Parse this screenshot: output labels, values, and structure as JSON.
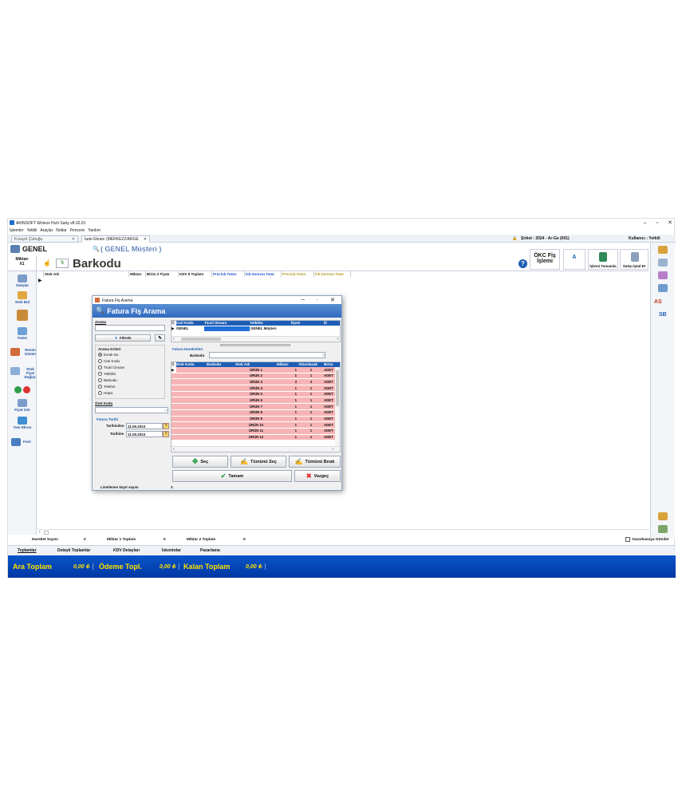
{
  "app": {
    "title": "AKINSOFT Wolvox Hızlı Satış v8.02.01",
    "menu": [
      "İşlemler",
      "Yetkili",
      "Araçlar",
      "Notlar",
      "Pencere",
      "Yardım"
    ],
    "tabs": [
      {
        "label": "Kısayol Çubuğu"
      },
      {
        "label": "İade Ekranı (MERKEZ2/ARGE"
      }
    ],
    "company": "Şirket : 2024 - Ar-Ge (001)",
    "user": "Kullanıcı : Yetkili"
  },
  "header": {
    "customer_code": "GENEL",
    "customer_name": "( GENEL Müşteri )",
    "qty_label": "Miktarı",
    "qty_value": "X1",
    "barcode_label": "Barkodu",
    "okc_label": "ÖKC Fiş İşlemi",
    "a_label": "A",
    "complete_label": "İşlemi Tamamla",
    "cancel_sale_label": "Satışı İptal Et"
  },
  "left_toolbar": [
    "Satışlar",
    "Stok Bul",
    "",
    "Paket",
    "Resim Göster",
    "Stok Fiyat Değişt.",
    "",
    "Fiyat Gör",
    "Tam Ekran",
    "Font"
  ],
  "right_toolbar": {
    "as": "AS",
    "sb": "SB"
  },
  "grid_columns": [
    "Stok Adı",
    "Miktarı",
    "Birim 2 Fiyatı",
    "KDV $ Toplam",
    "Prm.İsk.Tutarı",
    "İsk.Sonrası Tutar",
    "Prm.İsk.Tutarı",
    "İsk.Sonrası Tutar"
  ],
  "dialog": {
    "window_title": "Fatura Fiş Arama",
    "header": "Fatura Fiş Arama",
    "search_label": "Arama",
    "filter_button": "Filtrele",
    "criteria_label": "Arama Kriteri",
    "criteria": [
      "Evrak No",
      "Cari Kodu",
      "Ticari Ünvanı",
      "Yetkilisi",
      "Barkodu",
      "Telefon",
      "Hepsi"
    ],
    "special_code_label": "Özel Kodu",
    "invoice_date_label": "Fatura Tarihi",
    "date_from_label": "Tarihinden",
    "date_from": "11.06.2024",
    "date_to_label": "Tarihine",
    "date_to": "11.06.2024",
    "top_columns": [
      "Cari Kodu",
      "Ticari Ünvanı",
      "Yetkilisi",
      "İlçesi",
      "İli"
    ],
    "top_row": {
      "code": "GENEL",
      "name": "",
      "contact": "GENEL Müşteri"
    },
    "movements_label": "Fatura Hareketleri",
    "barcode_label": "Barkodu",
    "item_columns": [
      "Stok Kodu",
      "Barkodu",
      "Stok Adı",
      "Miktarı",
      "Aktarılacak",
      "Birim"
    ],
    "items": [
      {
        "name": "ÜRÜN 1",
        "qty": "1",
        "transfer": "1",
        "unit": "ADET"
      },
      {
        "name": "ÜRÜN 2",
        "qty": "1",
        "transfer": "1",
        "unit": "ADET"
      },
      {
        "name": "ÜRÜN 3",
        "qty": "3",
        "transfer": "3",
        "unit": "ADET"
      },
      {
        "name": "ÜRÜN 4",
        "qty": "1",
        "transfer": "1",
        "unit": "ADET"
      },
      {
        "name": "ÜRÜN 5",
        "qty": "1",
        "transfer": "1",
        "unit": "ADET"
      },
      {
        "name": "ÜRÜN 6",
        "qty": "1",
        "transfer": "1",
        "unit": "ADET"
      },
      {
        "name": "ÜRÜN 7",
        "qty": "1",
        "transfer": "1",
        "unit": "ADET"
      },
      {
        "name": "ÜRÜN 8",
        "qty": "1",
        "transfer": "1",
        "unit": "ADET"
      },
      {
        "name": "ÜRÜN 9",
        "qty": "1",
        "transfer": "1",
        "unit": "ADET"
      },
      {
        "name": "ÜRÜN 10",
        "qty": "1",
        "transfer": "1",
        "unit": "ADET"
      },
      {
        "name": "ÜRÜN 11",
        "qty": "1",
        "transfer": "1",
        "unit": "ADET"
      },
      {
        "name": "ÜRÜN 12",
        "qty": "1",
        "transfer": "1",
        "unit": "ADET"
      }
    ],
    "select_button": "Seç",
    "select_all_button": "Tümünü Seç",
    "clear_all_button": "Tümünü Bırak",
    "ok_button": "Tamam",
    "cancel_button": "Vazgeç",
    "record_count_label": "Listelenen kayıt sayısı",
    "record_count": "3"
  },
  "totals": {
    "movement_count_label": "Hareket Sayısı",
    "movement_count": "0",
    "qty1_label": "Miktar 1 Toplam",
    "qty1": "0",
    "qty2_label": "Miktar 2 Toplam",
    "qty2": "0",
    "printer_label": "Yazarkasaya Gönder"
  },
  "bottom_tabs": [
    "Toplamlar",
    "Detaylı Toplamlar",
    "KDV Detayları",
    "İskontolar",
    "Pazarlama"
  ],
  "summary": {
    "subtotal_label": "Ara Toplam",
    "subtotal": "0,00 ₺",
    "paid_label": "Ödeme Topl.",
    "paid": "0,00 ₺",
    "remaining_label": "Kalan Toplam",
    "remaining": "0,00 ₺"
  },
  "colors": {
    "accent": "#1e5db4",
    "row": "#f7b4b4",
    "total_text": "#ffe100"
  }
}
